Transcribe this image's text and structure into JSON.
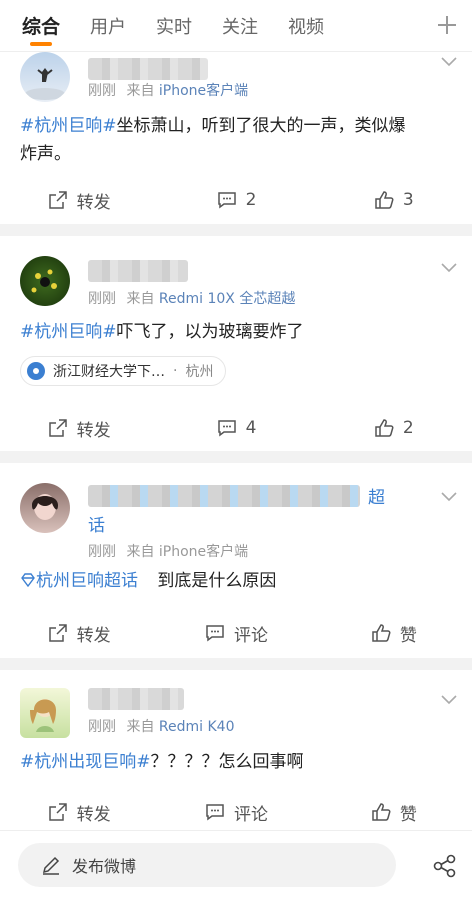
{
  "tabs": [
    "综合",
    "用户",
    "实时",
    "关注",
    "视频"
  ],
  "posts": [
    {
      "meta_time": "刚刚",
      "meta_from": "来自",
      "meta_source": "iPhone客户端",
      "tag": "#杭州巨响#",
      "text_line1": "坐标萧山，听到了很大的一声，类似爆",
      "text_line2": "炸声。",
      "repost": "转发",
      "comments": "2",
      "likes": "3"
    },
    {
      "meta_time": "刚刚",
      "meta_from": "来自",
      "meta_source": "Redmi 10X 全芯超越",
      "tag": "#杭州巨响#",
      "text": "吓飞了，以为玻璃要炸了",
      "location": "浙江财经大学下…",
      "location_sep": "·",
      "location_city": "杭州",
      "repost": "转发",
      "comments": "4",
      "likes": "2"
    },
    {
      "name_tail": "超",
      "name_line2": "话",
      "meta_time": "刚刚",
      "meta_from": "来自",
      "meta_source": "iPhone客户端",
      "tag": "杭州巨响超话",
      "text": "到底是什么原因",
      "repost": "转发",
      "comments": "评论",
      "likes": "赞"
    },
    {
      "meta_time": "刚刚",
      "meta_from": "来自",
      "meta_source": "Redmi K40",
      "tag": "#杭州出现巨响#",
      "text": "？？？？怎么回事啊",
      "repost": "转发",
      "comments": "评论",
      "likes": "赞"
    }
  ],
  "compose_label": "发布微博",
  "colors": {
    "accent": "#ff8200",
    "link": "#3b7fd1"
  }
}
